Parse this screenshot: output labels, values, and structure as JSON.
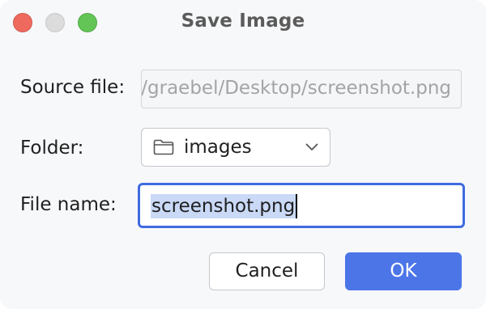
{
  "window": {
    "title": "Save Image",
    "controls": {
      "close": "close-icon",
      "minimize": "minimize-icon",
      "zoom": "zoom-icon"
    }
  },
  "form": {
    "source_file": {
      "label": "Source file:",
      "value": "/Users/graebel/Desktop/screenshot.png"
    },
    "folder": {
      "label": "Folder:",
      "value": "images",
      "icon": "folder-icon"
    },
    "file_name": {
      "label": "File name:",
      "value": "screenshot.png"
    }
  },
  "buttons": {
    "cancel": "Cancel",
    "ok": "OK"
  },
  "colors": {
    "accent": "#4c75e8",
    "focus_border": "#3f6be0",
    "selection": "#c9d9f6",
    "close": "#ee6a5f",
    "zoom": "#63c556"
  }
}
